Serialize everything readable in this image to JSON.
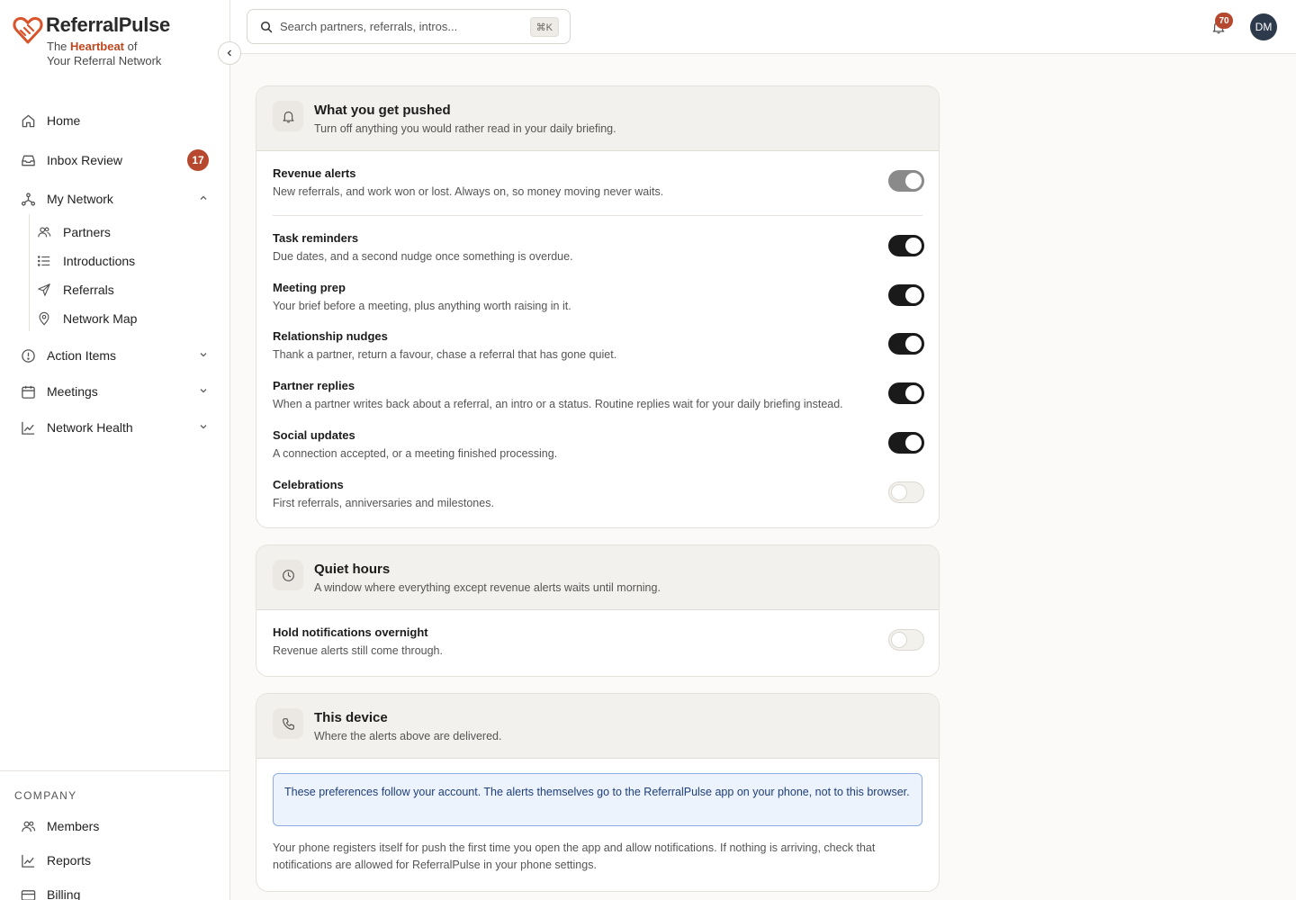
{
  "brand": {
    "name": "ReferralPulse",
    "tagline_pre": "The",
    "tagline_highlight": "Heartbeat",
    "tagline_post": "of",
    "tagline_line2": "Your Referral Network",
    "accent": "#c0471f"
  },
  "sidebar": {
    "home": "Home",
    "inbox_review": "Inbox Review",
    "inbox_badge": "17",
    "my_network": "My Network",
    "network_children": [
      "Partners",
      "Introductions",
      "Referrals",
      "Network Map"
    ],
    "action_items": "Action Items",
    "meetings": "Meetings",
    "network_health": "Network Health",
    "company_label": "COMPANY",
    "company_items": [
      "Members",
      "Reports",
      "Billing"
    ]
  },
  "topbar": {
    "search_placeholder": "Search partners, referrals, intros...",
    "search_shortcut": "⌘K",
    "notification_count": "70",
    "avatar_initials": "DM"
  },
  "pushed": {
    "title": "What you get pushed",
    "subtitle": "Turn off anything you would rather read in your daily briefing.",
    "rows": [
      {
        "title": "Revenue alerts",
        "desc": "New referrals, and work won or lost. Always on, so money moving never waits.",
        "state": "locked-on"
      },
      {
        "title": "Task reminders",
        "desc": "Due dates, and a second nudge once something is overdue.",
        "state": "on"
      },
      {
        "title": "Meeting prep",
        "desc": "Your brief before a meeting, plus anything worth raising in it.",
        "state": "on"
      },
      {
        "title": "Relationship nudges",
        "desc": "Thank a partner, return a favour, chase a referral that has gone quiet.",
        "state": "on"
      },
      {
        "title": "Partner replies",
        "desc": "When a partner writes back about a referral, an intro or a status. Routine replies wait for your daily briefing instead.",
        "state": "on"
      },
      {
        "title": "Social updates",
        "desc": "A connection accepted, or a meeting finished processing.",
        "state": "on"
      },
      {
        "title": "Celebrations",
        "desc": "First referrals, anniversaries and milestones.",
        "state": "off"
      }
    ]
  },
  "quiet": {
    "title": "Quiet hours",
    "subtitle": "A window where everything except revenue alerts waits until morning.",
    "row_title": "Hold notifications overnight",
    "row_desc": "Revenue alerts still come through.",
    "state": "off"
  },
  "device": {
    "title": "This device",
    "subtitle": "Where the alerts above are delivered.",
    "info": "These preferences follow your account. The alerts themselves go to the ReferralPulse app on your phone, not to this browser.",
    "note": "Your phone registers itself for push the first time you open the app and allow notifications. If nothing is arriving, check that notifications are allowed for ReferralPulse in your phone settings."
  }
}
